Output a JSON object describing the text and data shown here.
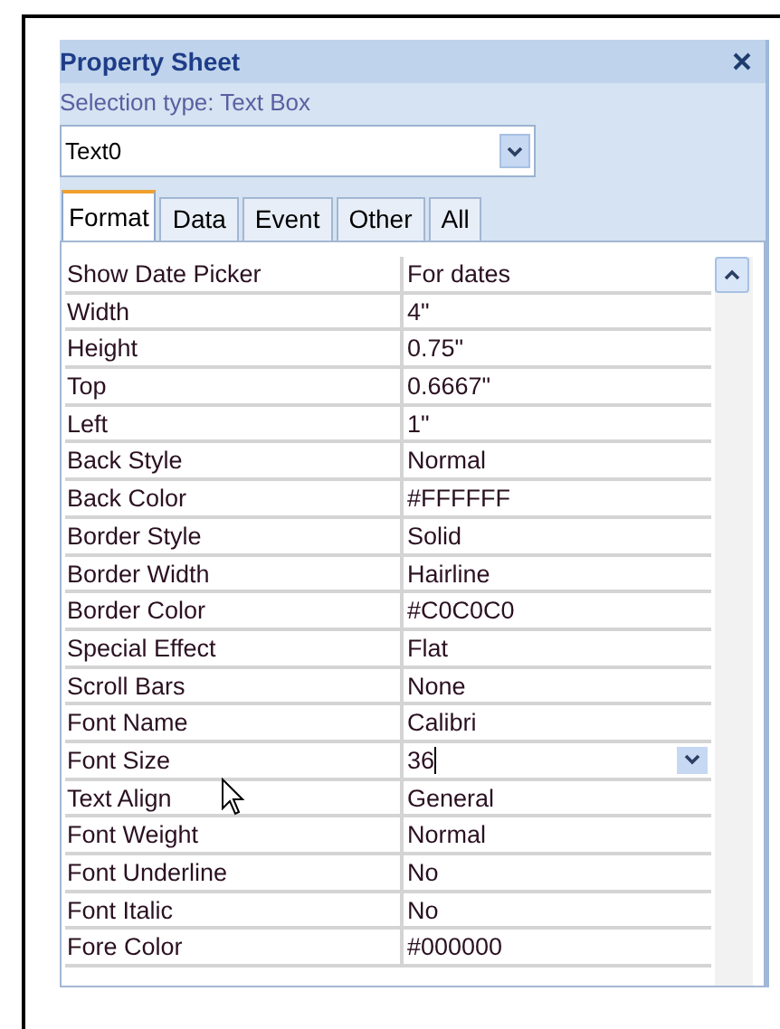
{
  "panel": {
    "title": "Property Sheet",
    "selection_type": "Selection type:  Text Box",
    "object_combo": {
      "value": "Text0"
    }
  },
  "tabs": [
    {
      "label": "Format",
      "selected": true
    },
    {
      "label": "Data",
      "selected": false
    },
    {
      "label": "Event",
      "selected": false
    },
    {
      "label": "Other",
      "selected": false
    },
    {
      "label": "All",
      "selected": false
    }
  ],
  "properties": [
    {
      "name": "Show Date Picker",
      "value": "For dates",
      "kind": "text"
    },
    {
      "name": "Width",
      "value": "4\"",
      "kind": "text"
    },
    {
      "name": "Height",
      "value": "0.75\"",
      "kind": "text"
    },
    {
      "name": "Top",
      "value": "0.6667\"",
      "kind": "text"
    },
    {
      "name": "Left",
      "value": "1\"",
      "kind": "text"
    },
    {
      "name": "Back Style",
      "value": "Normal",
      "kind": "text"
    },
    {
      "name": "Back Color",
      "value": "#FFFFFF",
      "kind": "text"
    },
    {
      "name": "Border Style",
      "value": "Solid",
      "kind": "text"
    },
    {
      "name": "Border Width",
      "value": "Hairline",
      "kind": "text"
    },
    {
      "name": "Border Color",
      "value": "#C0C0C0",
      "kind": "text"
    },
    {
      "name": "Special Effect",
      "value": "Flat",
      "kind": "text"
    },
    {
      "name": "Scroll Bars",
      "value": "None",
      "kind": "text"
    },
    {
      "name": "Font Name",
      "value": "Calibri",
      "kind": "text"
    },
    {
      "name": "Font Size",
      "value": "36",
      "kind": "dropdown"
    },
    {
      "name": "Text Align",
      "value": "General",
      "kind": "text"
    },
    {
      "name": "Font Weight",
      "value": "Normal",
      "kind": "text"
    },
    {
      "name": "Font Underline",
      "value": "No",
      "kind": "text"
    },
    {
      "name": "Font Italic",
      "value": "No",
      "kind": "text"
    },
    {
      "name": "Fore Color",
      "value": "#000000",
      "kind": "text"
    }
  ]
}
